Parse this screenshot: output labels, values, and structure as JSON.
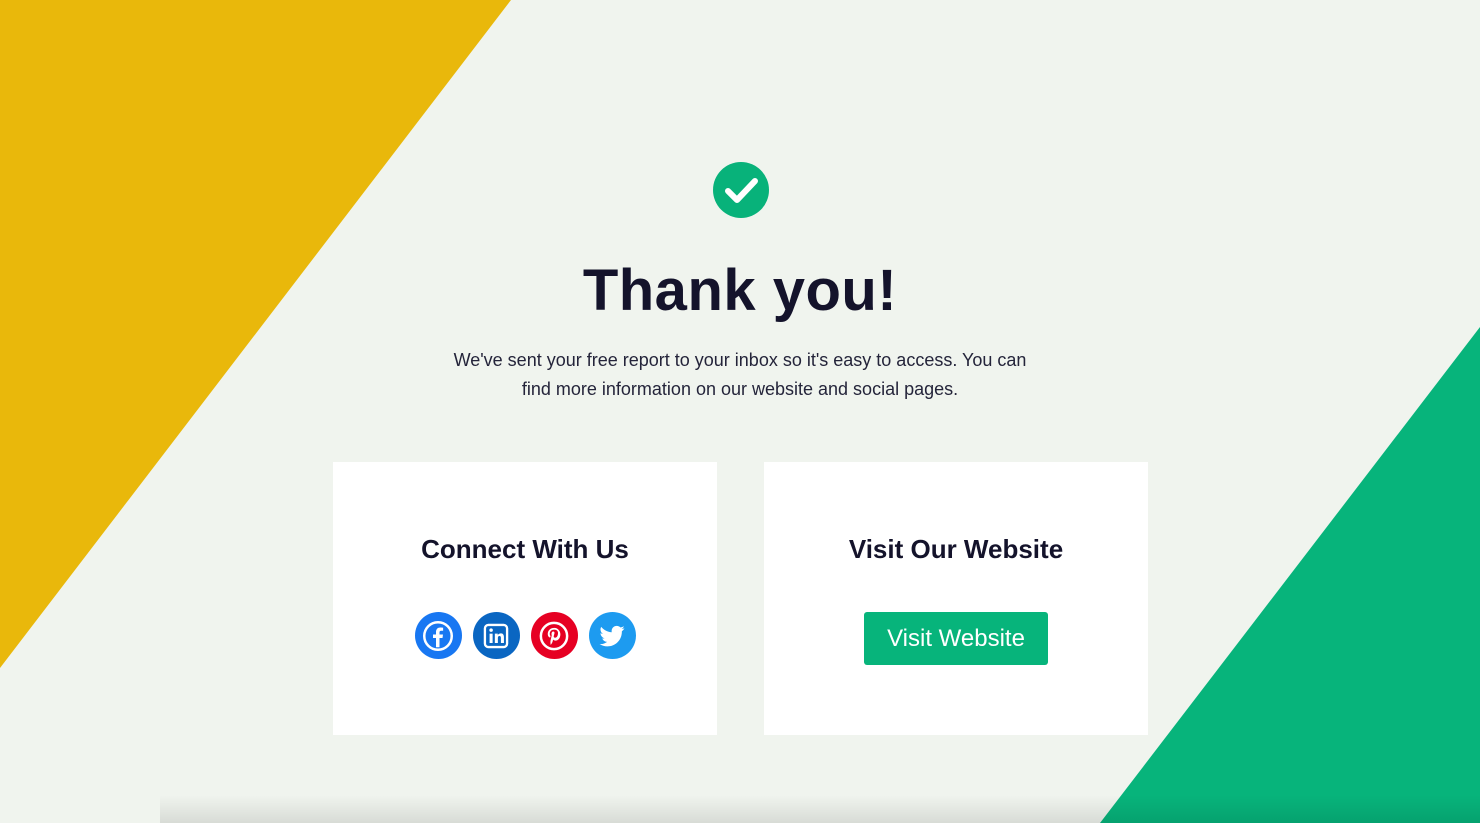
{
  "colors": {
    "background": "#f0f4ee",
    "yellow_shape": "#e9b80b",
    "green_shape": "#07b47b",
    "check_circle": "#08b27a",
    "facebook": "#1877f2",
    "linkedin": "#0a66c2",
    "pinterest": "#e60023",
    "twitter": "#1d9bf0",
    "button": "#07b47b"
  },
  "confirmation": {
    "icon": "check-circle-icon",
    "title": "Thank you!",
    "message": "We've sent your free report to your inbox so it's easy to access. You can find more information on our website and social pages."
  },
  "connect_card": {
    "title": "Connect With Us",
    "socials": [
      {
        "name": "facebook",
        "icon": "facebook-icon"
      },
      {
        "name": "linkedin",
        "icon": "linkedin-icon"
      },
      {
        "name": "pinterest",
        "icon": "pinterest-icon"
      },
      {
        "name": "twitter",
        "icon": "twitter-icon"
      }
    ]
  },
  "website_card": {
    "title": "Visit Our Website",
    "button_label": "Visit Website"
  }
}
